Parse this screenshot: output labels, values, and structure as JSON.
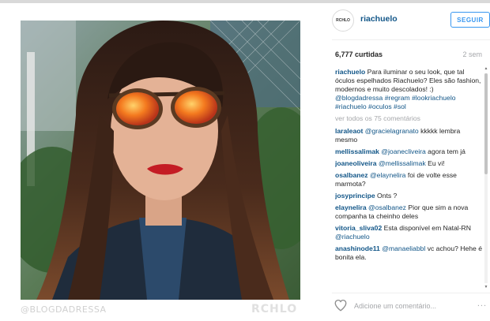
{
  "post": {
    "credit": "@BLOGDADRESSA",
    "watermark": "RCHLO"
  },
  "header": {
    "avatar_text": "RCHLO",
    "username": "riachuelo",
    "follow_label": "SEGUIR"
  },
  "stats": {
    "likes": "6,777 curtidas",
    "age": "2 sem"
  },
  "caption": {
    "author": "riachuelo",
    "text": "Para iluminar o seu look, que tal óculos espelhados Riachuelo? Eles são fashion, modernos e muito descolados! :) ",
    "tags": "@blogdadressa #regram #lookriachuelo #riachuelo #oculos #sol"
  },
  "view_all_label": "ver todos os 75 comentários",
  "comments": [
    {
      "author": "laraleaot",
      "mention": "@gracielagranato",
      "text": " kkkkk lembra mesmo"
    },
    {
      "author": "mellissalimak",
      "mention": "@joanecliveira",
      "text": " agora tem já"
    },
    {
      "author": "joaneoliveira",
      "mention": "@mellissalimak",
      "text": " Eu vi! "
    },
    {
      "author": "osalbanez",
      "mention": "@elaynelira",
      "text": " foi de volte esse marmota?"
    },
    {
      "author": "josyprincipe",
      "mention": "",
      "text": " Onts ?"
    },
    {
      "author": "elaynelira",
      "mention": "@osalbanez",
      "text": " Pior que sim  a nova companha ta cheinho deles"
    },
    {
      "author": "vitoria_sliva02",
      "mention": "@riachuelo",
      "text": " Esta disponível em Natal-RN "
    },
    {
      "author": "anashinode11",
      "mention": "@manaeliabbl",
      "text": " vc achou? Hehe é bonita ela."
    }
  ],
  "footer": {
    "comment_placeholder": "Adicione um comentário...",
    "more_label": "..."
  },
  "colors": {
    "link": "#125688",
    "follow": "#3897f0",
    "muted": "#a5a7aa"
  },
  "icons": [
    "heart-icon",
    "scroll-up-arrow-icon",
    "scroll-down-arrow-icon"
  ]
}
